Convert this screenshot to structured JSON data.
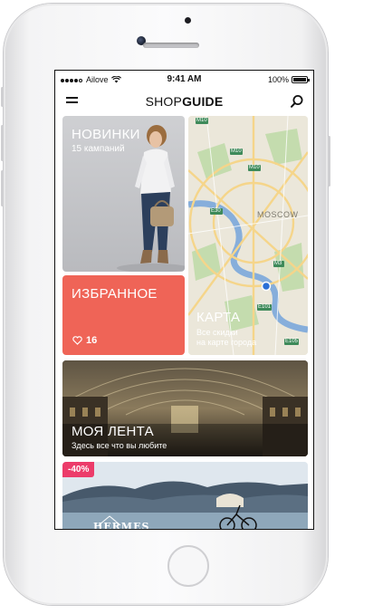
{
  "status_bar": {
    "carrier": "Ailove",
    "time": "9:41 AM",
    "battery": "100%",
    "signal_dots": 5
  },
  "nav": {
    "title_part1": "SHOP",
    "title_part2": "GUIDE",
    "menu_icon": "hamburger-menu-icon",
    "search_icon": "search-icon"
  },
  "tiles": {
    "new": {
      "title": "НОВИНКИ",
      "subtitle": "15 кампаний"
    },
    "favorites": {
      "title": "ИЗБРАННОЕ",
      "count": "16",
      "icon": "heart-icon"
    },
    "map": {
      "title": "КАРТА",
      "subtitle_line1": "Все скидки",
      "subtitle_line2": "на карте города",
      "city_label": "MOSCOW",
      "road_labels": [
        "M10",
        "M10",
        "M10",
        "E30",
        "M3",
        "E101",
        "E105"
      ]
    },
    "feed": {
      "title": "МОЯ ЛЕНТА",
      "subtitle": "Здесь все что вы любите"
    },
    "promo": {
      "discount": "-40%",
      "brand": "HERMES"
    }
  },
  "colors": {
    "favorites_bg": "#ef6457",
    "discount_bg": "#ec3c6a",
    "map_water": "#7fa8d8",
    "map_park": "#b9d6a0",
    "map_pin": "#2a6fd6"
  }
}
